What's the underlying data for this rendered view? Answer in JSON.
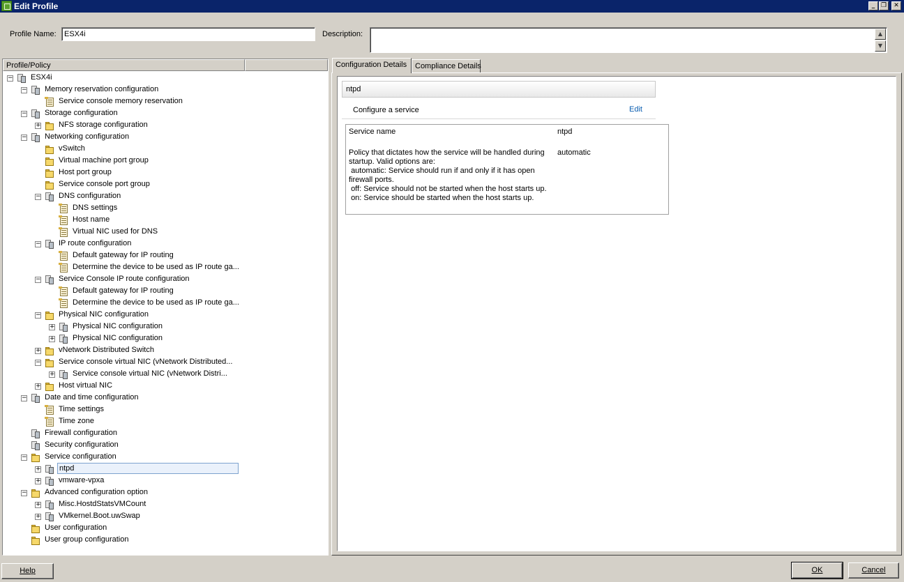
{
  "window": {
    "title": "Edit Profile",
    "minimize": "_",
    "restore": "❐",
    "close": "✕"
  },
  "form": {
    "profile_name_label": "Profile Name:",
    "profile_name_value": "ESX4i",
    "description_label": "Description:",
    "description_value": ""
  },
  "tree": {
    "columns": [
      "Profile/Policy",
      ""
    ],
    "items": [
      {
        "label": "ESX4i",
        "level": 0,
        "expander": "minus",
        "icon": "profile"
      },
      {
        "label": "Memory reservation configuration",
        "level": 1,
        "expander": "minus",
        "icon": "profile"
      },
      {
        "label": "Service console memory reservation",
        "level": 2,
        "expander": "none",
        "icon": "policy"
      },
      {
        "label": "Storage configuration",
        "level": 1,
        "expander": "minus",
        "icon": "profile"
      },
      {
        "label": "NFS storage configuration",
        "level": 2,
        "expander": "plus",
        "icon": "folder"
      },
      {
        "label": "Networking configuration",
        "level": 1,
        "expander": "minus",
        "icon": "profile"
      },
      {
        "label": "vSwitch",
        "level": 2,
        "expander": "none",
        "icon": "folder"
      },
      {
        "label": "Virtual machine port group",
        "level": 2,
        "expander": "none",
        "icon": "folder"
      },
      {
        "label": "Host port group",
        "level": 2,
        "expander": "none",
        "icon": "folder"
      },
      {
        "label": "Service console port group",
        "level": 2,
        "expander": "none",
        "icon": "folder"
      },
      {
        "label": "DNS configuration",
        "level": 2,
        "expander": "minus",
        "icon": "profile"
      },
      {
        "label": "DNS settings",
        "level": 3,
        "expander": "none",
        "icon": "policy"
      },
      {
        "label": "Host name",
        "level": 3,
        "expander": "none",
        "icon": "policy"
      },
      {
        "label": "Virtual NIC used for DNS",
        "level": 3,
        "expander": "none",
        "icon": "policy"
      },
      {
        "label": "IP route configuration",
        "level": 2,
        "expander": "minus",
        "icon": "profile"
      },
      {
        "label": "Default gateway for IP routing",
        "level": 3,
        "expander": "none",
        "icon": "policy"
      },
      {
        "label": "Determine the device to be used as IP route ga...",
        "level": 3,
        "expander": "none",
        "icon": "policy"
      },
      {
        "label": "Service Console IP route configuration",
        "level": 2,
        "expander": "minus",
        "icon": "profile"
      },
      {
        "label": "Default gateway for IP routing",
        "level": 3,
        "expander": "none",
        "icon": "policy"
      },
      {
        "label": "Determine the device to be used as IP route ga...",
        "level": 3,
        "expander": "none",
        "icon": "policy"
      },
      {
        "label": "Physical NIC configuration",
        "level": 2,
        "expander": "minus",
        "icon": "folder"
      },
      {
        "label": "Physical NIC configuration",
        "level": 3,
        "expander": "plus",
        "icon": "profile"
      },
      {
        "label": "Physical NIC configuration",
        "level": 3,
        "expander": "plus",
        "icon": "profile"
      },
      {
        "label": "vNetwork Distributed Switch",
        "level": 2,
        "expander": "plus",
        "icon": "folder"
      },
      {
        "label": "Service console virtual NIC (vNetwork Distributed...",
        "level": 2,
        "expander": "minus",
        "icon": "folder"
      },
      {
        "label": "Service console virtual NIC (vNetwork Distri...",
        "level": 3,
        "expander": "plus",
        "icon": "profile"
      },
      {
        "label": "Host virtual NIC",
        "level": 2,
        "expander": "plus",
        "icon": "folder"
      },
      {
        "label": "Date and time configuration",
        "level": 1,
        "expander": "minus",
        "icon": "profile"
      },
      {
        "label": "Time settings",
        "level": 2,
        "expander": "none",
        "icon": "policy"
      },
      {
        "label": "Time zone",
        "level": 2,
        "expander": "none",
        "icon": "policy"
      },
      {
        "label": "Firewall configuration",
        "level": 1,
        "expander": "none",
        "icon": "profile"
      },
      {
        "label": "Security configuration",
        "level": 1,
        "expander": "none",
        "icon": "profile"
      },
      {
        "label": "Service configuration",
        "level": 1,
        "expander": "minus",
        "icon": "folder"
      },
      {
        "label": "ntpd",
        "level": 2,
        "expander": "plus",
        "icon": "profile",
        "selected": true
      },
      {
        "label": "vmware-vpxa",
        "level": 2,
        "expander": "plus",
        "icon": "profile"
      },
      {
        "label": "Advanced configuration option",
        "level": 1,
        "expander": "minus",
        "icon": "folder"
      },
      {
        "label": "Misc.HostdStatsVMCount",
        "level": 2,
        "expander": "plus",
        "icon": "profile"
      },
      {
        "label": "VMkernel.Boot.uwSwap",
        "level": 2,
        "expander": "plus",
        "icon": "profile"
      },
      {
        "label": "User configuration",
        "level": 1,
        "expander": "none",
        "icon": "folder"
      },
      {
        "label": "User group configuration",
        "level": 1,
        "expander": "none",
        "icon": "folder"
      }
    ]
  },
  "tabs": [
    "Configuration Details",
    "Compliance Details"
  ],
  "details": {
    "header": "ntpd",
    "subheader": "Configure a service",
    "edit_link": "Edit",
    "rows": [
      {
        "key": "Service name",
        "value": "ntpd"
      },
      {
        "key": "Policy that dictates how the service will be handled during startup. Valid options are:\n automatic: Service should run if and only if it has open firewall ports.\n off: Service should not be started when the host starts up.\n on: Service should be started when the host starts up.",
        "value": "automatic"
      }
    ]
  },
  "buttons": {
    "help": "Help",
    "ok": "OK",
    "cancel": "Cancel"
  }
}
